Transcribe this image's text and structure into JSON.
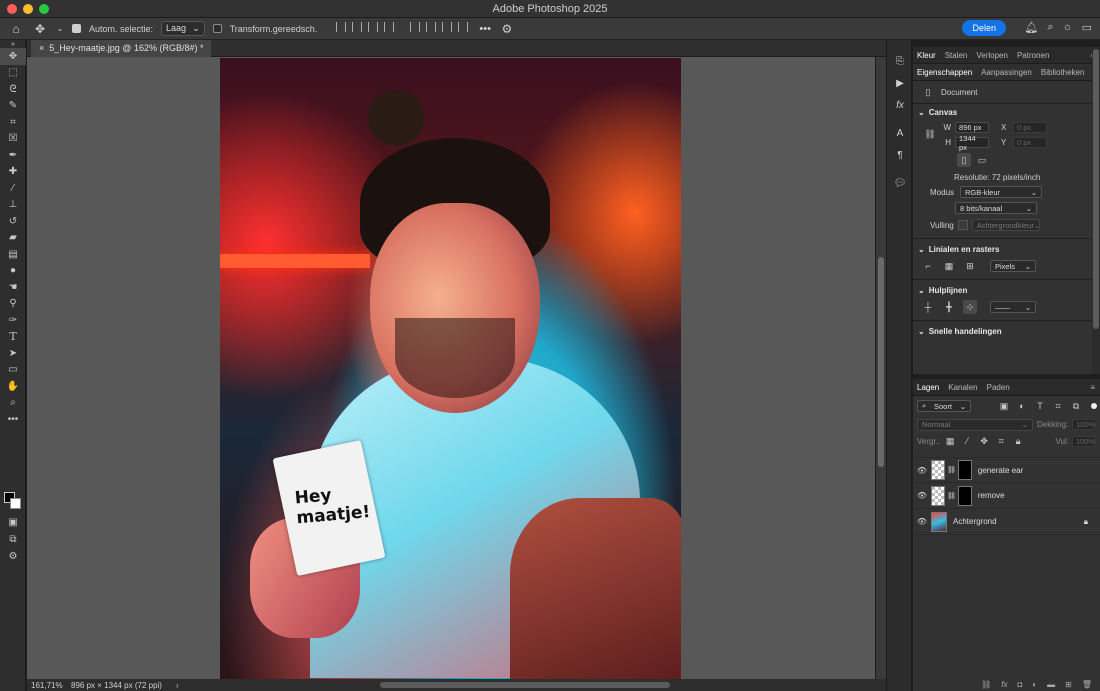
{
  "window": {
    "title": "Adobe Photoshop 2025",
    "traffic_colors": [
      "#ff5f57",
      "#febc2e",
      "#28c840"
    ]
  },
  "options_bar": {
    "auto_select_label": "Autom. selectie:",
    "auto_select_checked": true,
    "layer_select_value": "Laag",
    "transform_label": "Transform.gereedsch.",
    "transform_checked": false,
    "more_label": "•••",
    "share_label": "Delen",
    "share_color": "#1473e6"
  },
  "document": {
    "tab_title": "5_Hey-maatje.jpg @ 162% (RGB/8#) *",
    "close_glyph": "×"
  },
  "canvas_image": {
    "card_text": "Hey\nmaatje!"
  },
  "status": {
    "zoom": "161,71%",
    "info": "896 px × 1344 px (72 ppi)",
    "arrow": "›"
  },
  "tools": [
    "move-tool",
    "marquee-tool",
    "lasso-tool",
    "quick-select-tool",
    "crop-tool",
    "frame-tool",
    "eyedropper-tool",
    "healing-tool",
    "brush-tool",
    "stamp-tool",
    "history-brush-tool",
    "eraser-tool",
    "gradient-tool",
    "blur-tool",
    "smudge-tool",
    "dodge-tool",
    "pen-tool",
    "type-tool",
    "path-select-tool",
    "shape-tool",
    "hand-tool",
    "zoom-tool",
    "more-tools"
  ],
  "properties": {
    "tabs_top": [
      "Kleur",
      "Stalen",
      "Verlopen",
      "Patronen"
    ],
    "tabs_main": [
      "Eigenschappen",
      "Aanpassingen",
      "Bibliotheken"
    ],
    "doc_label": "Document",
    "canvas": {
      "title": "Canvas",
      "w_label": "W",
      "w_value": "896 px",
      "h_label": "H",
      "h_value": "1344 px",
      "x_label": "X",
      "x_value": "0 px",
      "y_label": "Y",
      "y_value": "0 px",
      "resolution": "Resolutie: 72 pixels/inch",
      "mode_label": "Modus",
      "mode_value": "RGB-kleur",
      "bits_value": "8 bits/kanaal",
      "fill_label": "Vulling",
      "fill_value": "Achtergrondkleur"
    },
    "rulers": {
      "title": "Linialen en rasters",
      "unit_value": "Pixels"
    },
    "guides": {
      "title": "Hulplijnen"
    },
    "quick": {
      "title": "Snelle handelingen"
    }
  },
  "layers": {
    "tabs": [
      "Lagen",
      "Kanalen",
      "Paden"
    ],
    "filter_value": "Soort",
    "blend_value": "Normaal",
    "opacity_label": "Dekking:",
    "opacity_value": "100%",
    "lock_label": "Vergr.:",
    "fill_label": "Vul:",
    "fill_value": "100%",
    "items": [
      {
        "name": "generate ear",
        "has_mask": true
      },
      {
        "name": "remove",
        "has_mask": true
      },
      {
        "name": "Achtergrond",
        "has_mask": false,
        "locked": true
      }
    ]
  }
}
